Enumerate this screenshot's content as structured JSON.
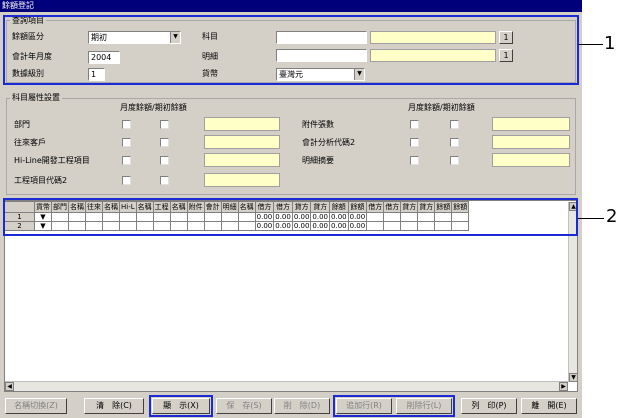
{
  "window": {
    "title": "餘額登記"
  },
  "query": {
    "group_title": "查詢項目",
    "balance_section_label": "餘額區分",
    "balance_section_value": "期初",
    "fiscal_year_label": "會計年月度",
    "fiscal_year_value": "2004",
    "level_label": "數據級別",
    "level_value": "1",
    "account_label": "科目",
    "account_value": "",
    "detail_label": "明細",
    "detail_value": "",
    "currency_label": "貨幣",
    "currency_value": "臺灣元",
    "lookup_button": "1"
  },
  "attributes": {
    "group_title": "科目屬性設置",
    "col_header_left": "月度餘額/期初餘額",
    "col_header_right": "月度餘額/期初餘額",
    "left_items": [
      "部門",
      "往來客戶",
      "Hi-Line開發工程項目",
      "工程項目代碼2"
    ],
    "right_items": [
      "附件張數",
      "會計分析代碼2",
      "明細摘要"
    ]
  },
  "grid": {
    "headers": [
      "貨幣",
      "部門",
      "名稱",
      "往來",
      "名稱",
      "Hi-L",
      "名稱",
      "工程",
      "名稱",
      "附件",
      "會計",
      "明細",
      "名稱",
      "借方",
      "借方",
      "貸方",
      "貸方",
      "餘額",
      "餘額",
      "借方",
      "借方",
      "貸方",
      "貸方",
      "餘額",
      "餘額"
    ],
    "rows": [
      {
        "num": "1",
        "values": [
          "0.00",
          "0.00",
          "0.00",
          "0.00",
          "0.00",
          "0.00"
        ]
      },
      {
        "num": "2",
        "values": [
          "0.00",
          "0.00",
          "0.00",
          "0.00",
          "0.00",
          "0.00"
        ]
      }
    ]
  },
  "buttons": {
    "rename": "名稱切換(Z)",
    "clear": "清　除(C)",
    "show": "顯　示(X)",
    "save": "保　存(S)",
    "delete": "削　除(D)",
    "add_row": "追加行(R)",
    "del_row": "削除行(L)",
    "print": "列　印(P)",
    "exit": "離　開(E)"
  },
  "callouts": {
    "one": "1",
    "two": "2"
  },
  "colors": {
    "highlight": "#1a2bd6",
    "title_bar": "#00007b",
    "input_yellow": "#ffffc8"
  }
}
